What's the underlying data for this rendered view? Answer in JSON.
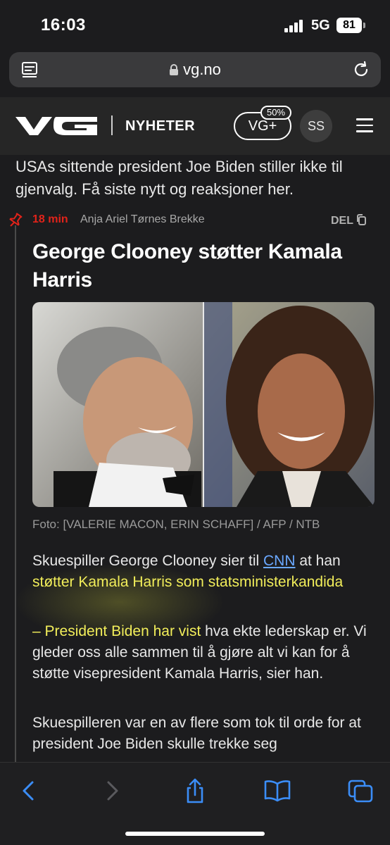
{
  "status": {
    "time": "16:03",
    "network": "5G",
    "battery": "81"
  },
  "browser": {
    "url": "vg.no"
  },
  "header": {
    "logo": "VG",
    "section": "NYHETER",
    "vgplus_label": "VG+",
    "vgplus_badge": "50%",
    "avatar_initials": "SS"
  },
  "article": {
    "lead": "USAs sittende president Joe Biden stiller ikke til gjenvalg. Få siste nytt og reaksjoner her.",
    "time_ago": "18 min",
    "author": "Anja Ariel Tørnes Brekke",
    "share_label": "DEL",
    "headline": "George Clooney støtter Kamala Harris",
    "caption": "Foto: [VALERIE MACON, ERIN SCHAFF] / AFP / NTB",
    "p1_a": "Skuespiller George Clooney sier til ",
    "p1_link": "CNN",
    "p1_b": " at han ",
    "p1_hl": "støtter Kamala Harris som statsministerkandida",
    "p2_hl": "– President Biden har vist",
    "p2_rest": " hva ekte lederskap er. Vi gleder oss alle sammen til å gjøre alt vi kan for å støtte visepresident Kamala Harris, sier han.",
    "p3": "Skuespilleren var en av flere som tok til orde for at president Joe Biden skulle trekke seg"
  },
  "toolbar": [
    "back-icon",
    "forward-icon",
    "share-icon",
    "bookmarks-icon",
    "tabs-icon"
  ],
  "colors": {
    "accent_red": "#e2231a",
    "link": "#6aa8ff",
    "highlight": "#f2ee5a",
    "background": "#1c1c1e"
  }
}
